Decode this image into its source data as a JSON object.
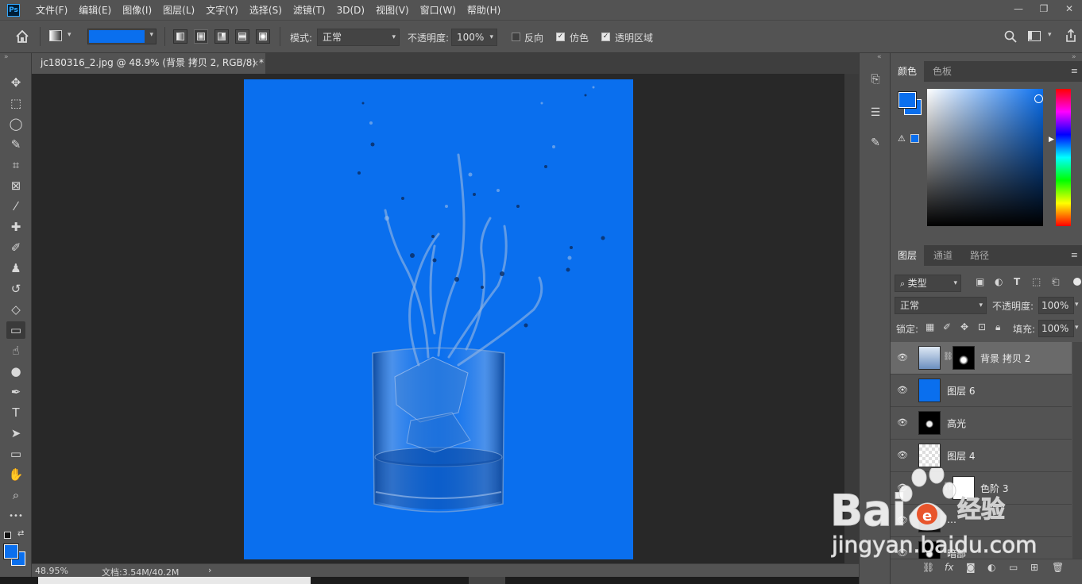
{
  "app": {
    "logo": "Ps"
  },
  "menu": [
    "文件(F)",
    "编辑(E)",
    "图像(I)",
    "图层(L)",
    "文字(Y)",
    "选择(S)",
    "滤镜(T)",
    "3D(D)",
    "视图(V)",
    "窗口(W)",
    "帮助(H)"
  ],
  "window_controls": {
    "minimize": "—",
    "restore": "❐",
    "close": "✕"
  },
  "options": {
    "mode_label": "模式:",
    "mode_value": "正常",
    "opacity_label": "不透明度:",
    "opacity_value": "100%",
    "reverse_label": "反向",
    "reverse_checked": false,
    "dither_label": "仿色",
    "dither_checked": true,
    "transparency_label": "透明区域",
    "transparency_checked": true,
    "gradient_color": "#0a6fee"
  },
  "document": {
    "tab_title": "jc180316_2.jpg @ 48.9% (背景 拷贝 2, RGB/8) *",
    "close": "×",
    "canvas_color": "#0a6fee"
  },
  "status": {
    "zoom": "48.95%",
    "doc_info": "文档:3.54M/40.2M",
    "arrow": "›"
  },
  "tools": [
    {
      "name": "move-tool",
      "glyph": "✥"
    },
    {
      "name": "marquee-tool",
      "glyph": "⬚"
    },
    {
      "name": "lasso-tool",
      "glyph": "◯"
    },
    {
      "name": "quick-select-tool",
      "glyph": "✎"
    },
    {
      "name": "crop-tool",
      "glyph": "⌗"
    },
    {
      "name": "frame-tool",
      "glyph": "⊠"
    },
    {
      "name": "eyedropper-tool",
      "glyph": "⁄"
    },
    {
      "name": "healing-tool",
      "glyph": "✚"
    },
    {
      "name": "brush-tool",
      "glyph": "✐"
    },
    {
      "name": "stamp-tool",
      "glyph": "♟"
    },
    {
      "name": "history-brush-tool",
      "glyph": "↺"
    },
    {
      "name": "eraser-tool",
      "glyph": "◇"
    },
    {
      "name": "gradient-tool",
      "glyph": "▭"
    },
    {
      "name": "smudge-tool",
      "glyph": "☝"
    },
    {
      "name": "dodge-tool",
      "glyph": "●"
    },
    {
      "name": "pen-tool",
      "glyph": "✒"
    },
    {
      "name": "type-tool",
      "glyph": "T"
    },
    {
      "name": "path-select-tool",
      "glyph": "➤"
    },
    {
      "name": "rectangle-tool",
      "glyph": "▭"
    },
    {
      "name": "hand-tool",
      "glyph": "✋"
    },
    {
      "name": "zoom-tool",
      "glyph": "⌕"
    },
    {
      "name": "more-tools",
      "glyph": "•••"
    }
  ],
  "color_panel": {
    "tabs": [
      "颜色",
      "色板"
    ],
    "foreground": "#0a6fee",
    "menu": "≡"
  },
  "layers_panel": {
    "tabs": [
      "图层",
      "通道",
      "路径"
    ],
    "filter_label": "类型",
    "blend_mode": "正常",
    "opacity_label": "不透明度:",
    "opacity_value": "100%",
    "lock_label": "锁定:",
    "fill_label": "填充:",
    "fill_value": "100%",
    "layers": [
      {
        "name": "背景 拷贝 2",
        "selected": true,
        "thumb": "glass",
        "mask": true
      },
      {
        "name": "图层 6",
        "selected": false,
        "thumb": "blue",
        "mask": false
      },
      {
        "name": "高光",
        "selected": false,
        "thumb": "black-splash",
        "mask": false
      },
      {
        "name": "图层 4",
        "selected": false,
        "thumb": "checker",
        "mask": false
      },
      {
        "name": "色阶 3",
        "selected": false,
        "thumb": "levels",
        "mask": true
      },
      {
        "name": "…",
        "selected": false,
        "thumb": "dark",
        "mask": false
      },
      {
        "name": "暗部",
        "selected": false,
        "thumb": "black-splash",
        "mask": false
      }
    ],
    "bottom_icons": [
      "link-icon",
      "fx-icon",
      "mask-icon",
      "adjustment-icon",
      "group-icon",
      "new-layer-icon",
      "trash-icon"
    ]
  },
  "watermark": {
    "brand": "Bai",
    "brand2": "经验",
    "url": "jingyan.baidu.com"
  }
}
